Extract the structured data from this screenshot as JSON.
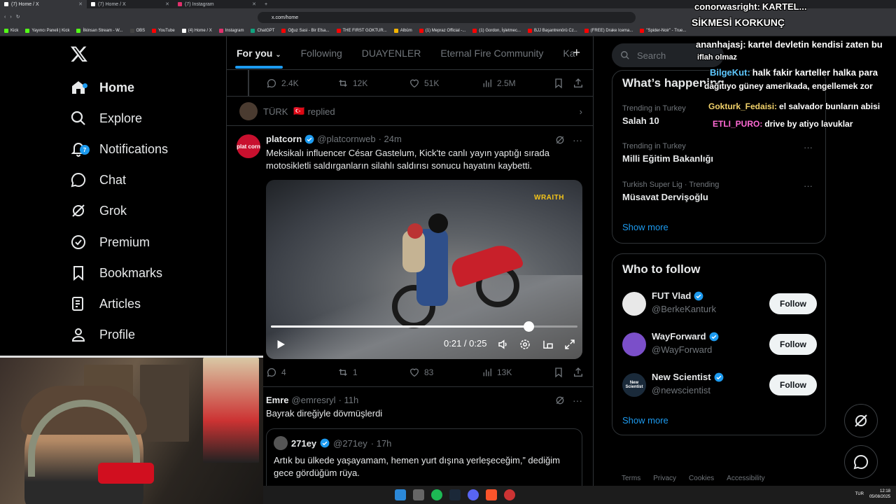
{
  "browser": {
    "tabs": [
      {
        "title": "(7) Home / X",
        "active": true
      },
      {
        "title": "(7) Home / X",
        "active": false
      },
      {
        "title": "(7) Instagram",
        "active": false
      }
    ],
    "url": "x.com/home",
    "bookmarks": [
      "Kick",
      "Yayıncı Paneli | Kick",
      "İlkinsan Stream - W...",
      "OBS",
      "YouTube",
      "(4) Home / X",
      "Instagram",
      "ChatGPT",
      "Oğuz Sasi - Bir Efsa...",
      "THE FIRST GOKTUR...",
      "Albüm",
      "(1) Mepraz Official -...",
      "(1) Gordon, İşletmec...",
      "BJJ Başantrenörü Cz...",
      "(FREE) Drake Icema...",
      "\"Spider-Noir\" - True..."
    ],
    "bookmark_colors": [
      "#53fc18",
      "#53fc18",
      "#53fc18",
      "#444444",
      "#ff0000",
      "#ffffff",
      "#e1306c",
      "#10a37f",
      "#ff0000",
      "#ff0000",
      "#f4b400",
      "#ff0000",
      "#ff0000",
      "#ff0000",
      "#ff0000",
      "#ff0000"
    ]
  },
  "nav": {
    "items": [
      {
        "label": "Home",
        "icon": "home-icon"
      },
      {
        "label": "Explore",
        "icon": "search-icon"
      },
      {
        "label": "Notifications",
        "icon": "bell-icon",
        "badge": "7"
      },
      {
        "label": "Chat",
        "icon": "chat-icon"
      },
      {
        "label": "Grok",
        "icon": "grok-icon"
      },
      {
        "label": "Premium",
        "icon": "premium-icon"
      },
      {
        "label": "Bookmarks",
        "icon": "bookmark-icon"
      },
      {
        "label": "Articles",
        "icon": "articles-icon"
      },
      {
        "label": "Profile",
        "icon": "profile-icon"
      }
    ]
  },
  "feed": {
    "tabs": [
      "For you",
      "Following",
      "DUAYENLER",
      "Eternal Fire Community",
      "Ka"
    ],
    "prev_post_stats": {
      "replies": "2.4K",
      "reposts": "12K",
      "likes": "51K",
      "views": "2.5M"
    },
    "replied_row": {
      "name": "TÜRK",
      "flag": "🇹🇷",
      "text": "replied"
    },
    "post": {
      "avatar_text": "plat corn",
      "name": "platcorn",
      "handle": "@platcornweb",
      "time": "· 24m",
      "text": "Meksikalı influencer César Gastelum, Kick'te canlı yayın yaptığı sırada motosikletli saldırganların silahlı saldırısı sonucu hayatını kaybetti.",
      "video": {
        "watermark": "WRAITH",
        "time_display": "0:21 / 0:25",
        "progress": 0.84
      },
      "stats": {
        "replies": "4",
        "reposts": "1",
        "likes": "83",
        "views": "13K"
      }
    },
    "post2": {
      "name": "Emre",
      "handle": "@emresryl",
      "time": "· 11h",
      "text": "Bayrak direğiyle dövmüşlerdi",
      "quote": {
        "name": "271ey",
        "handle": "@271ey",
        "time": "· 17h",
        "text": "Artık bu ülkede yaşayamam, hemen yurt dışına yerleşeceğim,” dediğim gece gördüğüm rüya."
      }
    }
  },
  "sidebar": {
    "search_placeholder": "Search",
    "happening_title": "What’s happening",
    "trends": [
      {
        "context": "Trending in Turkey",
        "topic": "Salah 10"
      },
      {
        "context": "Trending in Turkey",
        "topic": "Milli Eğitim Bakanlığı"
      },
      {
        "context": "Turkish Super Lig · Trending",
        "topic": "Müsavat Dervişoğlu"
      }
    ],
    "show_more": "Show more",
    "who_title": "Who to follow",
    "follow": [
      {
        "name": "FUT Vlad",
        "handle": "@BerkeKanturk",
        "color": "#e8e8e8"
      },
      {
        "name": "WayForward",
        "handle": "@WayForward",
        "color": "#7b4fc9"
      },
      {
        "name": "New Scientist",
        "handle": "@newscientist",
        "color": "#1a2a3a",
        "avatar_text": "New Scientist"
      }
    ],
    "follow_label": "Follow",
    "footer": [
      "Terms",
      "Privacy",
      "Cookies",
      "Accessibility"
    ]
  },
  "stream_chat": [
    {
      "user": "conorwasright:",
      "text": "KARTEL...",
      "color": "#ffffff"
    },
    {
      "user": "",
      "text": "SİKMESİ KORKUNÇ",
      "color": "#ffffff"
    },
    {
      "user": "ananhajasj:",
      "text": "kartel devletin kendisi zaten bu",
      "color": "#ffffff"
    },
    {
      "user": "",
      "text": "iflah olmaz",
      "color": "#ffffff"
    },
    {
      "user": "BilgeKut:",
      "text": "halk fakir karteller halka para",
      "color": "#5ec8ff"
    },
    {
      "user": "",
      "text": "dağıtıyo güney amerikada, engellemek zor",
      "color": "#ffffff"
    },
    {
      "user": "Gokturk_Fedaisi:",
      "text": "el salvador bunların abisi",
      "color": "#f3d36b"
    },
    {
      "user": "ETLI_PURO:",
      "text": "drive by atiyo lavuklar",
      "color": "#ff6ad5"
    }
  ],
  "taskbar": {
    "lang": "TUR",
    "time": "12:18",
    "date": "05/08/2025"
  }
}
